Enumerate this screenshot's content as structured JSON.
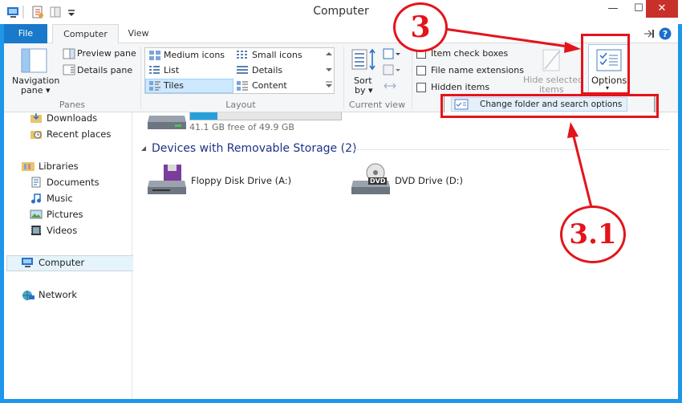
{
  "window": {
    "title": "Computer",
    "minimize": "—",
    "maximize": "☐",
    "close": "✕"
  },
  "tabs": {
    "file": "File",
    "computer": "Computer",
    "view": "View"
  },
  "ribbon": {
    "panes": {
      "navigation": "Navigation",
      "navigation2": "pane ▾",
      "preview": "Preview pane",
      "details": "Details pane",
      "label": "Panes"
    },
    "layout": {
      "medium": "Medium icons",
      "small": "Small icons",
      "list": "List",
      "details": "Details",
      "tiles": "Tiles",
      "content": "Content",
      "label": "Layout"
    },
    "current": {
      "sort1": "Sort",
      "sort2": "by ▾",
      "label": "Current view"
    },
    "showhide": {
      "checkboxes": "Item check boxes",
      "extensions": "File name extensions",
      "hidden": "Hidden items",
      "hide1": "Hide selected",
      "hide2": "items"
    },
    "options": {
      "label": "Options",
      "arrow": "▾"
    }
  },
  "dropdown": {
    "item": "Change folder and search options"
  },
  "nav": {
    "downloads": "Downloads",
    "recent": "Recent places",
    "libraries": "Libraries",
    "documents": "Documents",
    "music": "Music",
    "pictures": "Pictures",
    "videos": "Videos",
    "computer": "Computer",
    "network": "Network"
  },
  "content": {
    "drive_free": "41.1 GB free of 49.9 GB",
    "drive_fill": 0.18,
    "section": "Devices with Removable Storage (2)",
    "floppy": "Floppy Disk Drive (A:)",
    "dvd": "DVD Drive (D:)",
    "dvd_badge": "DVD"
  },
  "annotations": {
    "step3": "3",
    "step31": "3.1"
  },
  "colors": {
    "accent": "#1979ca",
    "annotation": "#e4141b"
  }
}
